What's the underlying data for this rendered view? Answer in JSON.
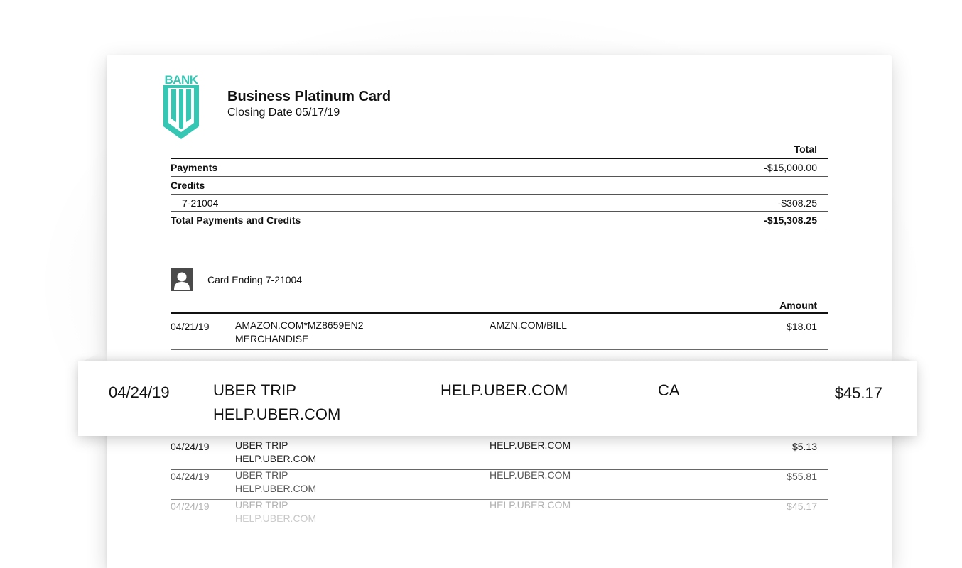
{
  "logo": {
    "text": "BANK",
    "color": "#35c7b4"
  },
  "header": {
    "title": "Business Platinum Card",
    "closing_date": "Closing Date 05/17/19"
  },
  "summary": {
    "total_header": "Total",
    "payments_label": "Payments",
    "payments_amount": "-$15,000.00",
    "credits_label": "Credits",
    "credit_card": "7-21004",
    "credit_amount": "-$308.25",
    "total_label": "Total Payments and Credits",
    "total_amount": "-$15,308.25"
  },
  "card": {
    "label": "Card Ending 7-21004",
    "icon": "user-avatar-icon"
  },
  "transactions": {
    "amount_header": "Amount",
    "rows": [
      {
        "date": "04/21/19",
        "merchant": "AMAZON.COM*MZ8659EN2",
        "desc": "MERCHANDISE",
        "web": "AMZN.COM/BILL",
        "amount": "$18.01"
      },
      {
        "date": "04/24/19",
        "merchant": "UBER TRIP",
        "desc": "HELP.UBER.COM",
        "web": "HELP.UBER.COM",
        "state": "CA",
        "amount": "$45.17"
      },
      {
        "date": "04/24/19",
        "merchant": "UBER TRIP",
        "desc": "HELP.UBER.COM",
        "web": "HELP.UBER.COM",
        "amount": "$5.13"
      },
      {
        "date": "04/24/19",
        "merchant": "UBER TRIP",
        "desc": "HELP.UBER.COM",
        "web": "HELP.UBER.COM",
        "amount": "$55.81"
      },
      {
        "date": "04/24/19",
        "merchant": "UBER TRIP",
        "desc": "HELP.UBER.COM",
        "web": "HELP.UBER.COM",
        "amount": "$45.17"
      }
    ]
  }
}
